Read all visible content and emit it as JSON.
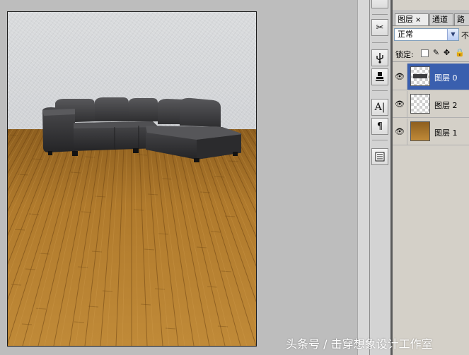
{
  "canvas": {
    "scene": "sofa-on-wood-floor",
    "colors": {
      "wall": "#d4d6d9",
      "floor": "#b07a2c",
      "sofa": "#3d3d3f"
    }
  },
  "toolbar": {
    "tools": [
      "scissors-icon",
      "usb-plug-icon",
      "stamp-icon",
      "text-tool-icon",
      "paragraph-icon",
      "notes-icon"
    ]
  },
  "layers_panel": {
    "tabs": [
      {
        "label": "图层",
        "active": true
      },
      {
        "label": "通道",
        "active": false
      },
      {
        "label": "路",
        "active": false
      }
    ],
    "tab_close": "×",
    "blend_mode": "正常",
    "opacity_label": "不",
    "lock_label": "锁定:",
    "layers": [
      {
        "name": "图层 0",
        "selected": true,
        "visible": true
      },
      {
        "name": "图层 2",
        "selected": false,
        "visible": true
      },
      {
        "name": "图层 1",
        "selected": false,
        "visible": true
      }
    ],
    "accent": "#3a5fae"
  },
  "watermark": "头条号 / 击穿想象设计工作室"
}
